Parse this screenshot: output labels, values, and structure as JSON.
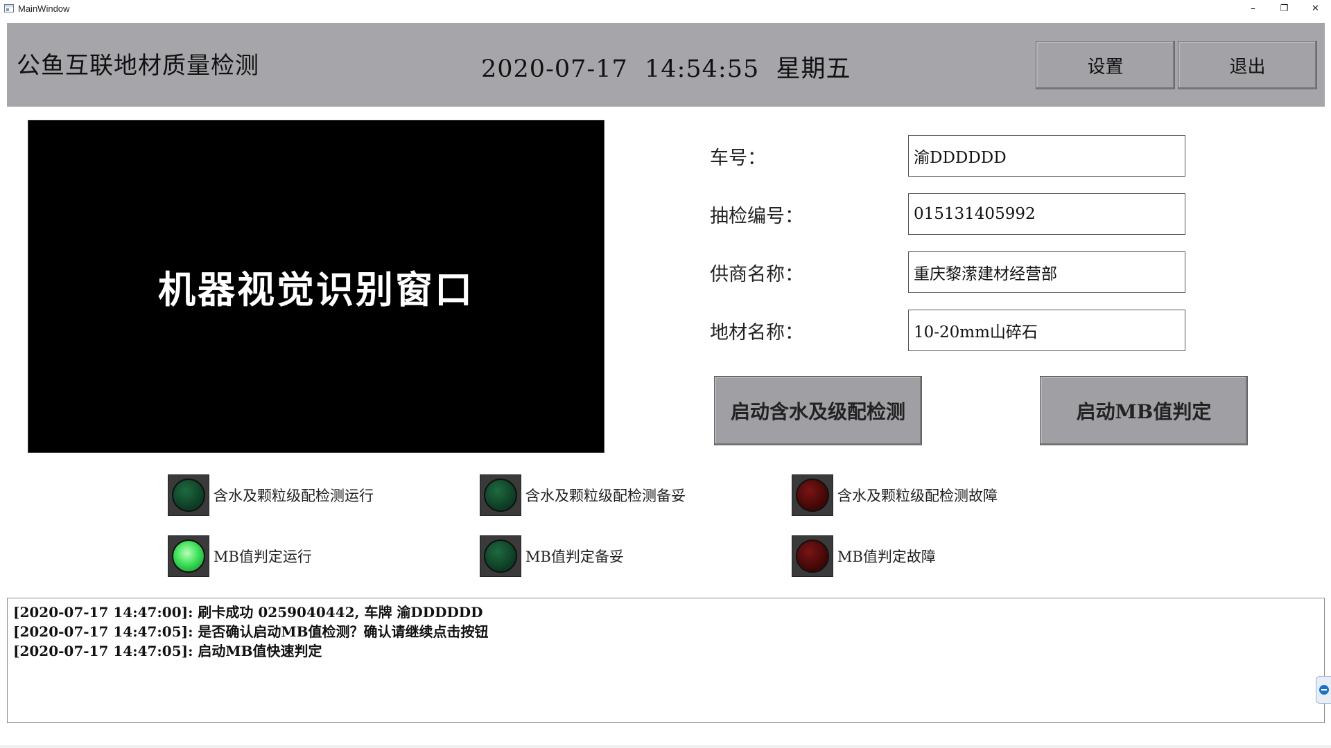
{
  "window": {
    "title": "MainWindow",
    "minimize": "–",
    "restore": "❐",
    "close": "✕"
  },
  "header": {
    "app_name": "公鱼互联地材质量检测",
    "datetime": "2020-07-17  14:54:55  星期五",
    "settings_label": "设置",
    "exit_label": "退出"
  },
  "vision": {
    "label": "机器视觉识别窗口"
  },
  "form": {
    "vehicle": {
      "label": "车号：",
      "value": "渝DDDDDD"
    },
    "sample_no": {
      "label": "抽检编号：",
      "value": "015131405992"
    },
    "supplier": {
      "label": "供商名称：",
      "value": "重庆黎潆建材经营部"
    },
    "material": {
      "label": "地材名称：",
      "value": "10-20mm山碎石"
    }
  },
  "actions": {
    "start_water": "启动含水及级配检测",
    "start_mb": "启动MB值判定"
  },
  "indicators": [
    {
      "label": "含水及颗粒级配检测运行",
      "state": "green-off"
    },
    {
      "label": "含水及颗粒级配检测备妥",
      "state": "green-off"
    },
    {
      "label": "含水及颗粒级配检测故障",
      "state": "red-off"
    },
    {
      "label": "MB值判定运行",
      "state": "green-on"
    },
    {
      "label": "MB值判定备妥",
      "state": "green-off"
    },
    {
      "label": "MB值判定故障",
      "state": "red-off"
    }
  ],
  "log": [
    "[2020-07-17 14:47:00]: 刷卡成功 0259040442, 车牌 渝DDDDDD",
    "[2020-07-17 14:47:05]: 是否确认启动MB值检测？确认请继续点击按钮",
    "[2020-07-17 14:47:05]: 启动MB值快速判定"
  ],
  "colors": {
    "header_bg": "#a6a6aa",
    "green_on": "#3fe25a",
    "green_off": "#0c3a22",
    "red_off": "#3e0606"
  }
}
